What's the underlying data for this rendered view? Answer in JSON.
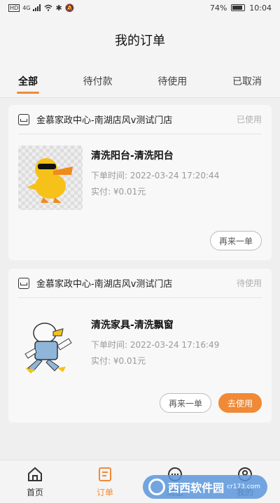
{
  "status_bar": {
    "left_icons": [
      "HD",
      "4G",
      "signal",
      "wifi",
      "bluetooth",
      "mute"
    ],
    "battery": "74%",
    "time": "10:04"
  },
  "header": {
    "title": "我的订单"
  },
  "tabs": [
    {
      "label": "全部",
      "active": true
    },
    {
      "label": "待付款",
      "active": false
    },
    {
      "label": "待使用",
      "active": false
    },
    {
      "label": "已取消",
      "active": false
    }
  ],
  "orders": [
    {
      "store": "金慕家政中心-南湖店风v测试门店",
      "status": "已使用",
      "title": "清洗阳台-清洗阳台",
      "time_label": "下单时间:",
      "time": "2022-03-24 17:20:44",
      "paid_label": "实付:",
      "paid": "¥0.01元",
      "thumb": "duck-sunglasses",
      "buttons": [
        "再来一单"
      ]
    },
    {
      "store": "金慕家政中心-南湖店风v测试门店",
      "status": "待使用",
      "title": "清洗家具-清洗飘窗",
      "time_label": "下单时间:",
      "time": "2022-03-24 17:16:49",
      "paid_label": "实付:",
      "paid": "¥0.01元",
      "thumb": "duck-overalls",
      "buttons": [
        "再来一单",
        "去使用"
      ]
    }
  ],
  "bottom_nav": [
    {
      "label": "首页",
      "icon": "home-icon",
      "active": false
    },
    {
      "label": "订单",
      "icon": "order-icon",
      "active": true
    },
    {
      "label": "消息",
      "icon": "message-icon",
      "active": false
    },
    {
      "label": "我的",
      "icon": "profile-icon",
      "active": false
    }
  ],
  "watermark": {
    "text": "西西软件园",
    "sub": "cr173.com"
  },
  "colors": {
    "accent": "#f08a36",
    "muted": "#999999"
  }
}
